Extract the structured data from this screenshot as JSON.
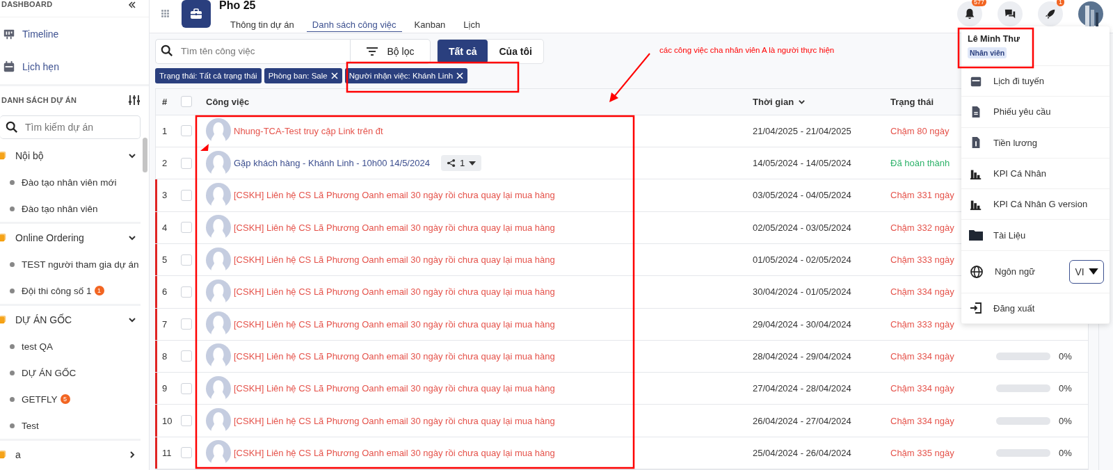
{
  "sidebar": {
    "dashboard_label": "DASHBOARD",
    "nav": [
      {
        "label": "Timeline"
      },
      {
        "label": "Lịch hẹn"
      }
    ],
    "projects_label": "DANH SÁCH DỰ ÁN",
    "search": {
      "placeholder": "Tìm kiếm dự án"
    },
    "groups": [
      {
        "name": "Nội bộ",
        "expanded": true,
        "children": [
          {
            "name": "Đào tạo nhân viên mới"
          },
          {
            "name": "Đào tạo nhân viên"
          }
        ]
      },
      {
        "name": "Online Ordering",
        "expanded": true,
        "children": [
          {
            "name": "TEST người tham gia dự án"
          },
          {
            "name": "Đội thi công số 1",
            "badge": "1"
          }
        ]
      },
      {
        "name": "DỰ ÁN GỐC",
        "expanded": true,
        "children": [
          {
            "name": "test QA"
          },
          {
            "name": "DỰ ÁN GỐC"
          },
          {
            "name": "GETFLY",
            "badge": "5"
          },
          {
            "name": "Test"
          }
        ]
      },
      {
        "name": "a",
        "expanded": false
      }
    ]
  },
  "header": {
    "title": "Pho 25",
    "tabs": [
      {
        "label": "Thông tin dự án",
        "selected": false
      },
      {
        "label": "Danh sách công việc",
        "selected": true
      },
      {
        "label": "Kanban",
        "selected": false
      },
      {
        "label": "Lịch",
        "selected": false
      }
    ],
    "notifications": "577",
    "rocket_badge": "1"
  },
  "toolbar": {
    "search": {
      "placeholder": "Tìm tên công việc"
    },
    "filter_button": "Bộ lọc",
    "scope": [
      {
        "label": "Tất cả",
        "selected": true
      },
      {
        "label": "Của tôi",
        "selected": false
      }
    ]
  },
  "filters": [
    {
      "label": "Trạng thái: Tất cả trạng thái",
      "removable": false
    },
    {
      "label": "Phòng ban: Sale",
      "removable": true
    },
    {
      "label": "Người nhận việc: Khánh Linh",
      "removable": true
    }
  ],
  "table": {
    "columns": [
      "#",
      "Công việc",
      "Thời gian",
      "Trạng thái"
    ],
    "all_checked": false,
    "rows": [
      {
        "index": "1",
        "checked": false,
        "flagged": false,
        "task": "Nhung-TCA-Test truy cập Link trên đt",
        "time": "21/04/2025 - 21/04/2025",
        "status": "Chậm 80 ngày",
        "kind": "late"
      },
      {
        "index": "2",
        "checked": false,
        "flagged": false,
        "task": "Gặp khách hàng - Khánh Linh - 10h00 14/5/2024",
        "subtasks": "1",
        "time": "14/05/2024 - 14/05/2024",
        "status": "Đã hoàn thành",
        "kind": "done"
      },
      {
        "index": "3",
        "checked": false,
        "flagged": true,
        "task": "[CSKH] Liên hệ CS Lã Phương Oanh email 30 ngày rồi chưa quay lại mua hàng",
        "time": "03/05/2024 - 04/05/2024",
        "status": "Chậm 331 ngày",
        "kind": "late"
      },
      {
        "index": "4",
        "checked": false,
        "flagged": true,
        "task": "[CSKH] Liên hệ CS Lã Phương Oanh email 30 ngày rồi chưa quay lại mua hàng",
        "time": "02/05/2024 - 03/05/2024",
        "status": "Chậm 332 ngày",
        "kind": "late"
      },
      {
        "index": "5",
        "checked": false,
        "flagged": true,
        "task": "[CSKH] Liên hệ CS Lã Phương Oanh email 30 ngày rồi chưa quay lại mua hàng",
        "time": "01/05/2024 - 02/05/2024",
        "status": "Chậm 333 ngày",
        "kind": "late"
      },
      {
        "index": "6",
        "checked": false,
        "flagged": true,
        "task": "[CSKH] Liên hệ CS Lã Phương Oanh email 30 ngày rồi chưa quay lại mua hàng",
        "time": "30/04/2024 - 01/05/2024",
        "status": "Chậm 334 ngày",
        "kind": "late"
      },
      {
        "index": "7",
        "checked": false,
        "flagged": true,
        "task": "[CSKH] Liên hệ CS Lã Phương Oanh email 30 ngày rồi chưa quay lại mua hàng",
        "time": "29/04/2024 - 30/04/2024",
        "status": "Chậm 333 ngày",
        "kind": "late"
      },
      {
        "index": "8",
        "checked": false,
        "flagged": true,
        "task": "[CSKH] Liên hệ CS Lã Phương Oanh email 30 ngày rồi chưa quay lại mua hàng",
        "time": "28/04/2024 - 29/04/2024",
        "status": "Chậm 334 ngày",
        "kind": "late",
        "level": 0,
        "percent": "0%"
      },
      {
        "index": "9",
        "checked": false,
        "flagged": true,
        "task": "[CSKH] Liên hệ CS Lã Phương Oanh email 30 ngày rồi chưa quay lại mua hàng",
        "time": "27/04/2024 - 28/04/2024",
        "status": "Chậm 334 ngày",
        "kind": "late",
        "level": 0,
        "percent": "0%"
      },
      {
        "index": "10",
        "checked": false,
        "flagged": true,
        "task": "[CSKH] Liên hệ CS Lã Phương Oanh email 30 ngày rồi chưa quay lại mua hàng",
        "time": "26/04/2024 - 27/04/2024",
        "status": "Chậm 334 ngày",
        "kind": "late",
        "level": 0,
        "percent": "0%"
      },
      {
        "index": "11",
        "checked": false,
        "flagged": true,
        "task": "[CSKH] Liên hệ CS Lã Phương Oanh email 30 ngày rồi chưa quay lại mua hàng",
        "time": "25/04/2024 - 26/04/2024",
        "status": "Chậm 335 ngày",
        "kind": "late",
        "level": 0,
        "percent": "0%"
      }
    ]
  },
  "user_menu": {
    "name": "Lê Minh Thư",
    "role": "Nhân viên",
    "items": [
      {
        "label": "Lịch đi tuyến"
      },
      {
        "label": "Phiếu yêu cầu"
      },
      {
        "label": "Tiền lương"
      },
      {
        "label": "KPI Cá Nhân"
      },
      {
        "label": "KPI Cá Nhân G version"
      },
      {
        "label": "Tài Liệu"
      }
    ],
    "language_label": "Ngôn ngữ",
    "language": "VI",
    "logout": "Đăng xuất"
  },
  "annotation": {
    "note": "các công việc cha nhân viên A là người thực hiện"
  }
}
